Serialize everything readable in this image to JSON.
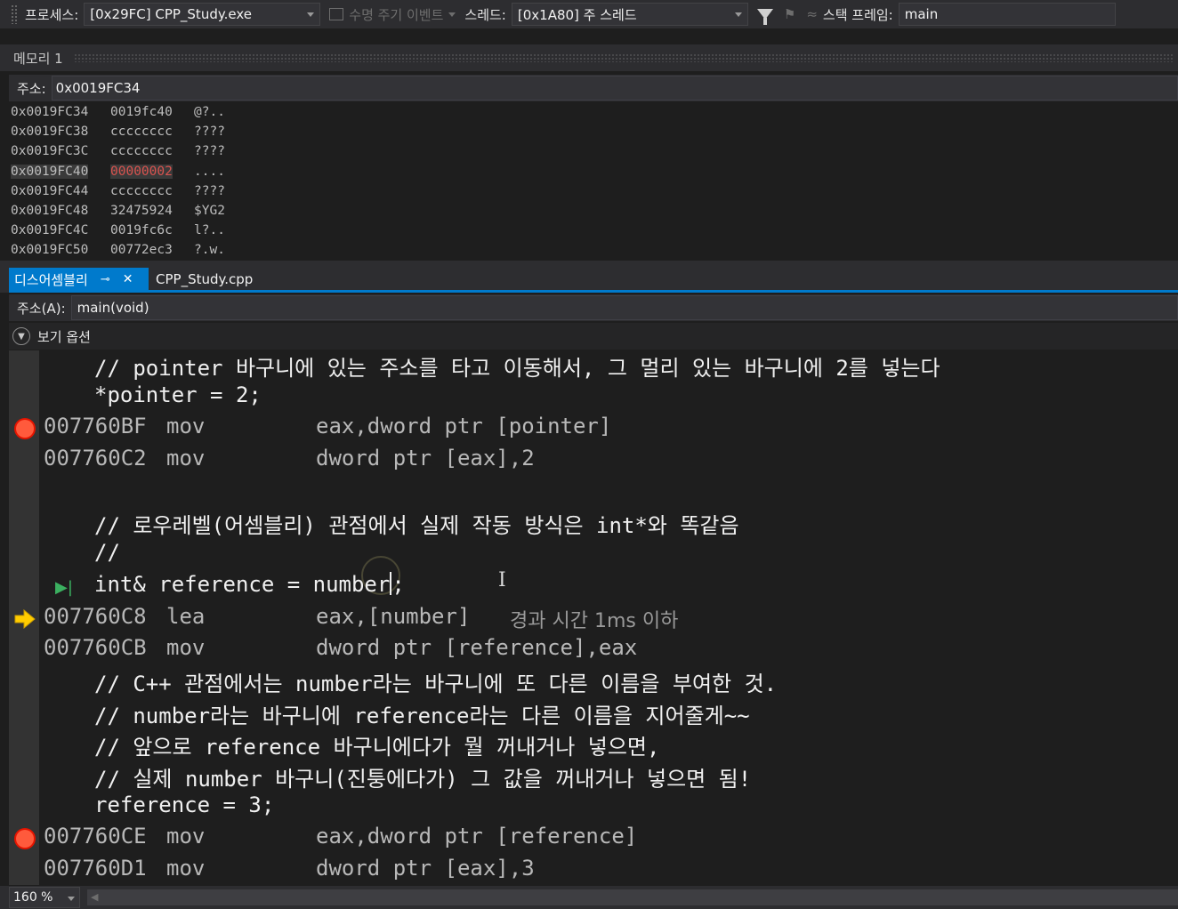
{
  "toolbar": {
    "process_label": "프로세스:",
    "process_value": "[0x29FC] CPP_Study.exe",
    "lifecycle_events": "수명 주기 이벤트",
    "thread_label": "스레드:",
    "thread_value": "[0x1A80] 주 스레드",
    "stackframe_label": "스택 프레임:",
    "stackframe_value": "main"
  },
  "memory": {
    "title": "메모리 1",
    "address_label": "주소:",
    "address_value": "0x0019FC34",
    "rows": [
      {
        "addr": "0x0019FC34",
        "hex": "0019fc40",
        "chars": "@?.."
      },
      {
        "addr": "0x0019FC38",
        "hex": "cccccccc",
        "chars": "????"
      },
      {
        "addr": "0x0019FC3C",
        "hex": "cccccccc",
        "chars": "????"
      },
      {
        "addr": "0x0019FC40",
        "hex": "00000002",
        "chars": "...."
      },
      {
        "addr": "0x0019FC44",
        "hex": "cccccccc",
        "chars": "????"
      },
      {
        "addr": "0x0019FC48",
        "hex": "32475924",
        "chars": "$YG2"
      },
      {
        "addr": "0x0019FC4C",
        "hex": "0019fc6c",
        "chars": "l?.."
      },
      {
        "addr": "0x0019FC50",
        "hex": "00772ec3",
        "chars": "?.w."
      }
    ],
    "changed_row": 3
  },
  "tabs": {
    "active": "디스어셈블리",
    "pin": "⊸",
    "close": "✕",
    "second": "CPP_Study.cpp"
  },
  "disasm": {
    "address_label": "주소(A):",
    "address_value": "main(void)",
    "view_options": "보기 옵션",
    "src1": "// pointer 바구니에 있는 주소를 타고 이동해서, 그 멀리 있는 바구니에 2를 넣는다",
    "src2": "*pointer = 2;",
    "asm1": {
      "addr": "007760BF",
      "mn": "mov",
      "op": "eax,dword ptr [pointer]"
    },
    "asm2": {
      "addr": "007760C2",
      "mn": "mov",
      "op": "dword ptr [eax],2"
    },
    "src3": "// 로우레벨(어셈블리) 관점에서 실제 작동 방식은 int*와 똑같음",
    "src4": "//",
    "src5": "int& reference = number",
    "src5_tail": ";",
    "asm3": {
      "addr": "007760C8",
      "mn": "lea",
      "op": "eax,[number]"
    },
    "elapsed": "경과 시간 1ms 이하",
    "asm4": {
      "addr": "007760CB",
      "mn": "mov",
      "op": "dword ptr [reference],eax"
    },
    "src6": "// C++ 관점에서는 number라는 바구니에 또 다른 이름을 부여한 것.",
    "src7": "// number라는 바구니에 reference라는 다른 이름을 지어줄게~~",
    "src8": "// 앞으로 reference 바구니에다가 뭘 꺼내거나 넣으면,",
    "src9": "// 실제 number 바구니(진퉁에다가) 그 값을 꺼내거나 넣으면 됨!",
    "src10": "reference = 3;",
    "asm5": {
      "addr": "007760CE",
      "mn": "mov",
      "op": "eax,dword ptr [reference]"
    },
    "asm6": {
      "addr": "007760D1",
      "mn": "mov",
      "op": "dword ptr [eax],3"
    }
  },
  "status": {
    "zoom": "160 %"
  },
  "colors": {
    "accent": "#007acc",
    "breakpoint": "#e51400",
    "current_statement": "#ffcc00",
    "changed_value": "#d9534f"
  }
}
